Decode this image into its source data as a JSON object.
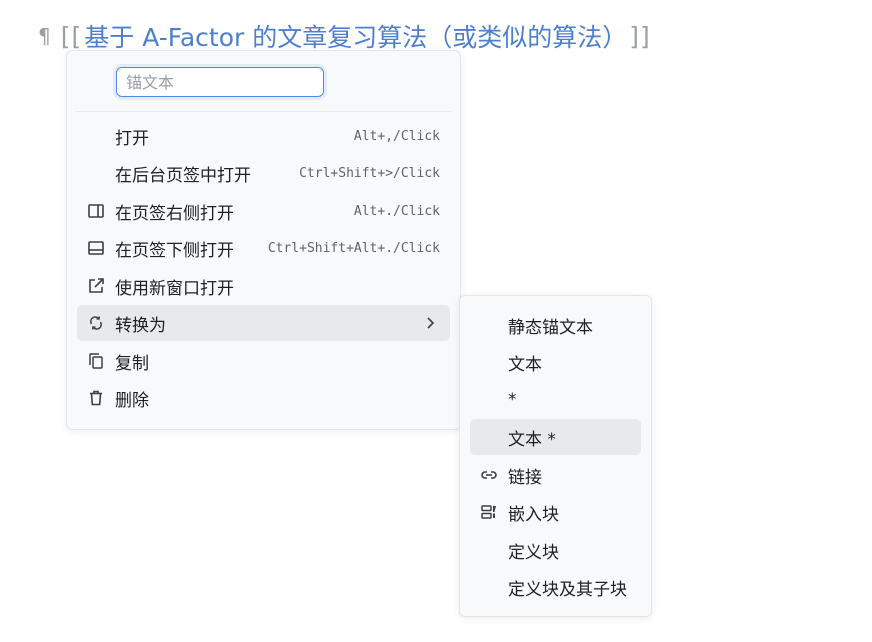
{
  "editor": {
    "pilcrow": "¶",
    "open_brackets": "[[",
    "link_text": "基于 A-Factor 的文章复习算法（或类似的算法）",
    "close_brackets": "]]"
  },
  "context_menu": {
    "anchor_input": {
      "placeholder": "锚文本",
      "value": ""
    },
    "items": [
      {
        "label": "打开",
        "shortcut": "Alt+,/Click",
        "icon": "none"
      },
      {
        "label": "在后台页签中打开",
        "shortcut": "Ctrl+Shift+>/Click",
        "icon": "none"
      },
      {
        "label": "在页签右侧打开",
        "shortcut": "Alt+./Click",
        "icon": "split-right-icon"
      },
      {
        "label": "在页签下侧打开",
        "shortcut": "Ctrl+Shift+Alt+./Click",
        "icon": "split-bottom-icon"
      },
      {
        "label": "使用新窗口打开",
        "shortcut": "",
        "icon": "external-window-icon"
      },
      {
        "label": "转换为",
        "shortcut": "",
        "icon": "refresh-icon",
        "has_submenu": true,
        "active": true
      },
      {
        "label": "复制",
        "shortcut": "",
        "icon": "copy-icon"
      },
      {
        "label": "删除",
        "shortcut": "",
        "icon": "trash-icon"
      }
    ]
  },
  "submenu": {
    "items": [
      {
        "label": "静态锚文本",
        "icon": "none"
      },
      {
        "label": "文本",
        "icon": "none"
      },
      {
        "label": "*",
        "icon": "none"
      },
      {
        "label": "文本 *",
        "icon": "none",
        "active": true
      },
      {
        "label": "链接",
        "icon": "link-icon"
      },
      {
        "label": "嵌入块",
        "icon": "embed-block-icon"
      },
      {
        "label": "定义块",
        "icon": "none"
      },
      {
        "label": "定义块及其子块",
        "icon": "none"
      }
    ]
  },
  "colors": {
    "link": "#4e7fcf",
    "active_row": "#e8e9eb",
    "menu_bg": "#f8f9fa",
    "input_focus": "#4a8be8"
  }
}
